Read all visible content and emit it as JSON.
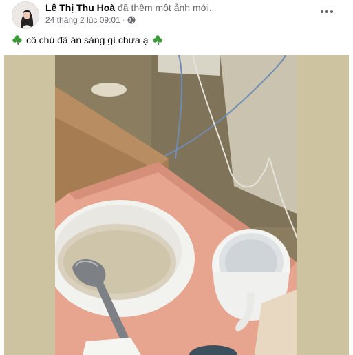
{
  "post": {
    "author_name": "Lê Thị Thu Hoà",
    "action_text": "đã thêm một ảnh mới.",
    "timestamp": "24 tháng 2 lúc 09:01",
    "separator": "·",
    "privacy_icon": "globe-icon",
    "more_icon": "more-options-icon",
    "caption": "cô chú đã ăn sáng gì chưa ạ",
    "caption_emoji": "shamrock-icon"
  },
  "colors": {
    "name_text": "#050505",
    "meta_text": "#65676b",
    "photo_border": "#cdc3a1",
    "clover": "#3c9a3a"
  }
}
